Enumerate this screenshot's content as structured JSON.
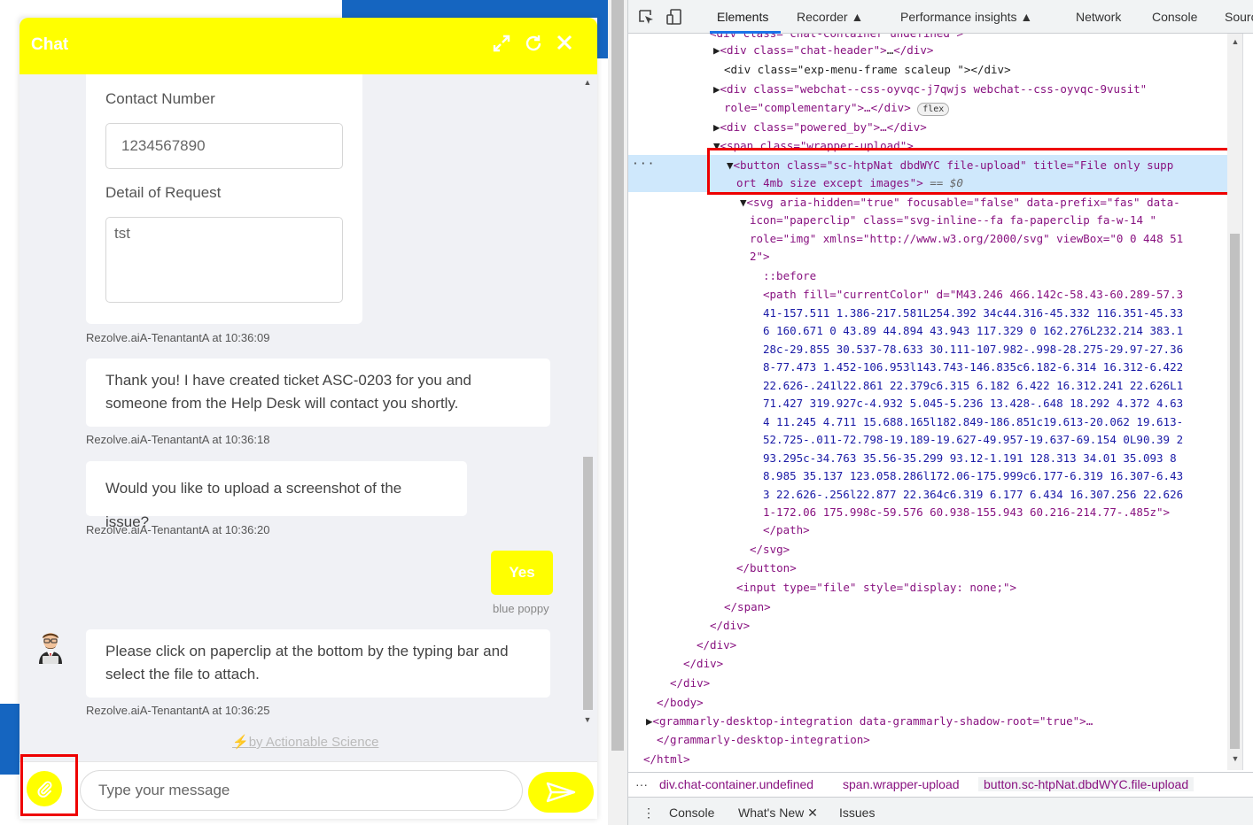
{
  "chat": {
    "title": "Chat",
    "form": {
      "contact_label": "Contact Number",
      "contact_value": "1234567890",
      "detail_label": "Detail of Request",
      "detail_value": "tst"
    },
    "messages": [
      {
        "meta": "Rezolve.aiA-TenantantA at 10:36:09"
      },
      {
        "text": "Thank you! I have created ticket ASC-0203 for you and someone from the Help Desk will contact you shortly.",
        "meta": "Rezolve.aiA-TenantantA at 10:36:18"
      },
      {
        "text": "Would you like to upload a screenshot of the issue?",
        "meta": "Rezolve.aiA-TenantantA at 10:36:20"
      },
      {
        "text": "Please click on paperclip at the bottom by the typing bar and select the file to attach.",
        "meta": "Rezolve.aiA-TenantantA at 10:36:25"
      }
    ],
    "user_reply": {
      "text": "Yes",
      "name": "blue poppy"
    },
    "powered_by": "by Actionable Science",
    "input_placeholder": "Type your message"
  },
  "devtools": {
    "tabs": [
      "Elements",
      "Recorder",
      "Performance insights",
      "Network",
      "Console",
      "Sourc"
    ],
    "active_tab": "Elements",
    "dom": {
      "l0": "<div class=\"chat-container undefined\">",
      "l1": [
        "<div class=\"chat-header\">",
        "…",
        "</div>"
      ],
      "l2": "<div class=\"exp-menu-frame scaleup \"></div>",
      "l3a": "<div class=\"webchat--css-oyvqc-j7qwjs webchat--css-oyvqc-9vusit\"",
      "l3b": "role=\"complementary\">…</div>",
      "l3_badge": "flex",
      "l4": "<div class=\"powered_by\">…</div>",
      "l5": "<span class=\"wrapper-upload\">",
      "l6a": "<button class=\"sc-htpNat dbdWYC file-upload\" title=\"File only supp",
      "l6b": "ort 4mb size except images\">",
      "l6_eq": " == $0",
      "l7a": "<svg aria-hidden=\"true\" focusable=\"false\" data-prefix=\"fas\" data-",
      "l7b": "icon=\"paperclip\" class=\"svg-inline--fa fa-paperclip fa-w-14 \"",
      "l7c": "role=\"img\" xmlns=\"http://www.w3.org/2000/svg\" viewBox=\"0 0 448 51",
      "l7d": "2\">",
      "before": "::before",
      "path_lines": [
        "<path fill=\"currentColor\" d=\"M43.246 466.142c-58.43-60.289-57.3",
        "41-157.511 1.386-217.581L254.392 34c44.316-45.332 116.351-45.33",
        "6 160.671 0 43.89 44.894 43.943 117.329 0 162.276L232.214 383.1",
        "28c-29.855 30.537-78.633 30.111-107.982-.998-28.275-29.97-27.36",
        "8-77.473 1.452-106.953l143.743-146.835c6.182-6.314 16.312-6.422",
        "22.626-.241l22.861 22.379c6.315 6.182 6.422 16.312.241 22.626L1",
        "71.427 319.927c-4.932 5.045-5.236 13.428-.648 18.292 4.372 4.63",
        "4 11.245 4.711 15.688.165l182.849-186.851c19.613-20.062 19.613-",
        "52.725-.011-72.798-19.189-19.627-49.957-19.637-69.154 0L90.39 2",
        "93.295c-34.763 35.56-35.299 93.12-1.191 128.313 34.01 35.093 8",
        "8.985 35.137 123.058.286l172.06-175.999c6.177-6.319 16.307-6.43",
        "3 22.626-.256l22.877 22.364c6.319 6.177 6.434 16.307.256 22.626",
        "1-172.06 175.998c-59.576 60.938-155.943 60.216-214.77-.485z\">"
      ],
      "close_path": "</path>",
      "close_svg": "</svg>",
      "close_button": "</button>",
      "input_line": "<input type=\"file\" style=\"display: none;\">",
      "close_span": "</span>",
      "close_div": "</div>",
      "close_body": "</body>",
      "grammarly_open": "<grammarly-desktop-integration data-grammarly-shadow-root=\"true\">…",
      "grammarly_close": "</grammarly-desktop-integration>",
      "close_html": "</html>"
    },
    "breadcrumbs": [
      "div.chat-container.undefined",
      "span.wrapper-upload",
      "button.sc-htpNat.dbdWYC.file-upload"
    ],
    "drawer_tabs": [
      "Console",
      "What's New",
      "Issues"
    ]
  },
  "colors": {
    "accent_yellow": "#ffff00",
    "highlight_red": "#ee0000",
    "devtools_tag": "#881280",
    "devtools_attr": "#994500",
    "devtools_value": "#1a1aa6",
    "selection_blue": "#cfe8fc"
  }
}
